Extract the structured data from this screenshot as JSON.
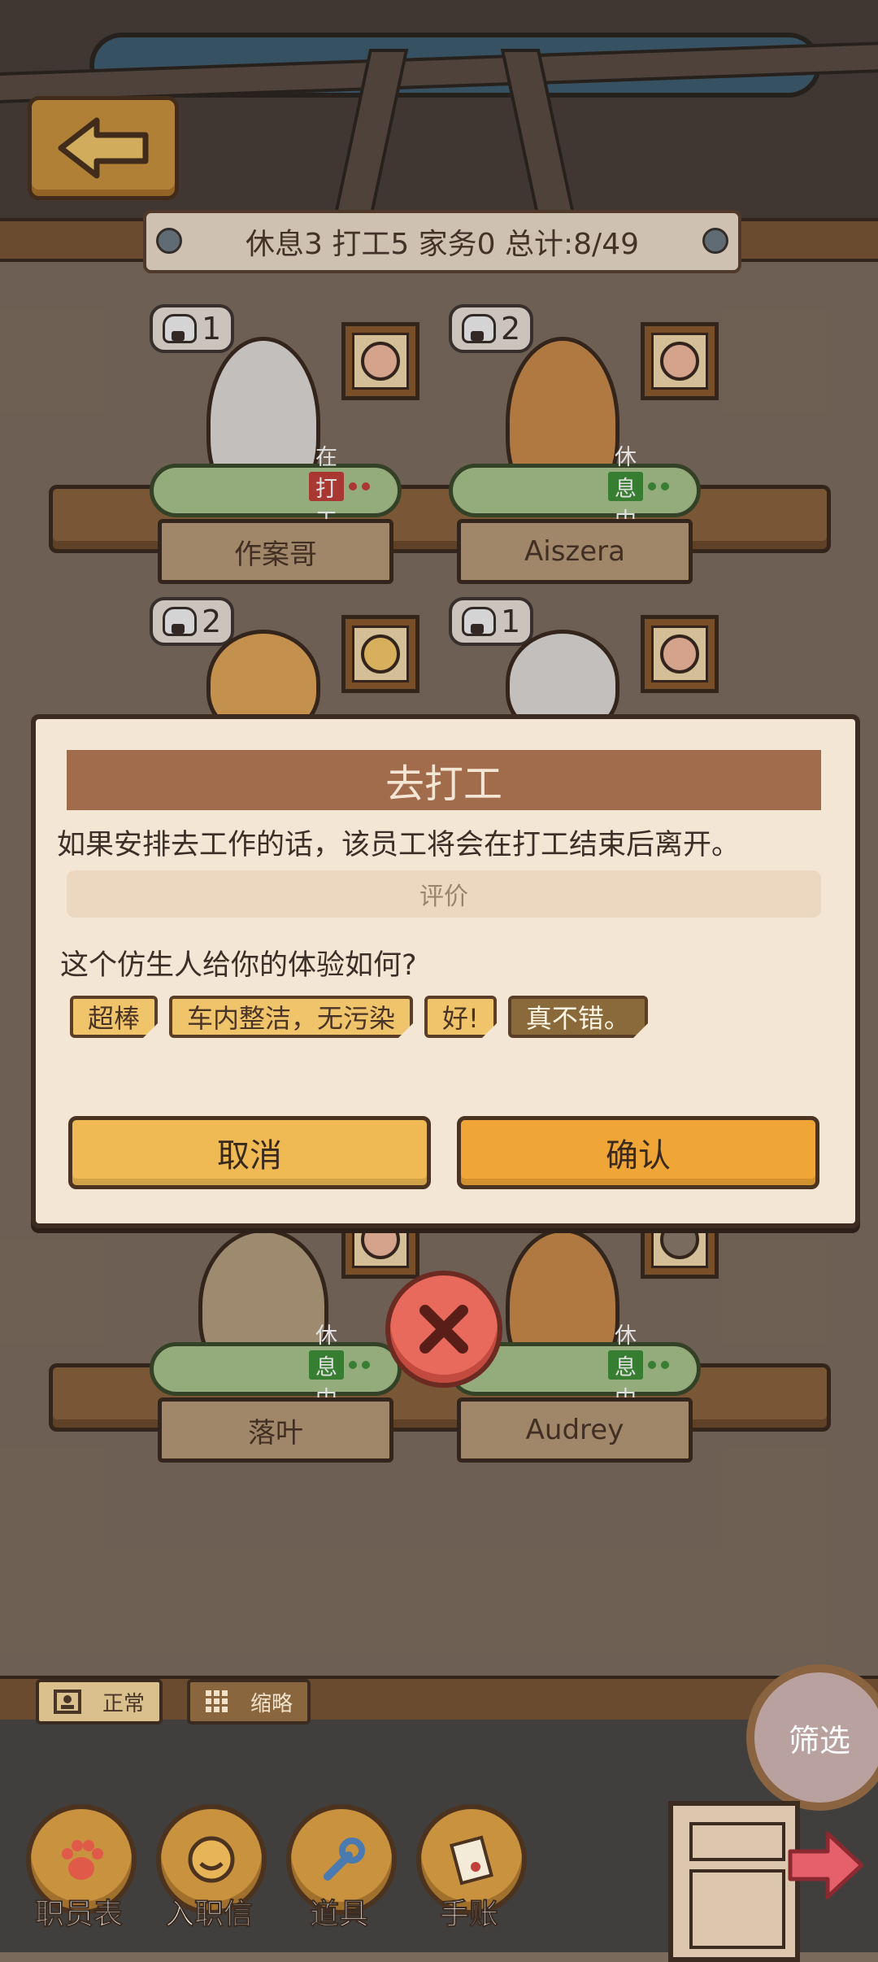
{
  "header": {
    "back_icon": "arrow-left-icon",
    "summary": "休息3 打工5 家务0 总计:8/49"
  },
  "staff": [
    {
      "name": "作案哥",
      "count": "1",
      "status": "在打工",
      "status_color": "#c2403a"
    },
    {
      "name": "Aiszera",
      "count": "2",
      "status": "休息中",
      "status_color": "#3f8f3a"
    },
    {
      "name": "",
      "count": "2",
      "status": "",
      "status_color": ""
    },
    {
      "name": "",
      "count": "1",
      "status": "",
      "status_color": ""
    },
    {
      "name": "落叶",
      "count": "",
      "status": "休息中",
      "status_color": "#3f8f3a"
    },
    {
      "name": "Audrey",
      "count": "",
      "status": "休息中",
      "status_color": "#3f8f3a"
    }
  ],
  "dialog": {
    "title": "去打工",
    "message": "如果安排去工作的话，该员工将会在打工结束后离开。",
    "rating_label": "评价",
    "question": "这个仿生人给你的体验如何?",
    "tags": [
      {
        "label": "超棒",
        "selected": false
      },
      {
        "label": "车内整洁，无污染",
        "selected": false
      },
      {
        "label": "好!",
        "selected": false
      },
      {
        "label": "真不错。",
        "selected": true
      }
    ],
    "cancel": "取消",
    "confirm": "确认",
    "close_icon": "close-icon"
  },
  "view_toggle": {
    "normal": "正常",
    "thumbnail": "缩略"
  },
  "filter": "筛选",
  "nav": [
    {
      "label": "职员表",
      "icon": "paw-icon"
    },
    {
      "label": "入职信",
      "icon": "coin-icon"
    },
    {
      "label": "道具",
      "icon": "wrench-icon"
    },
    {
      "label": "手账",
      "icon": "notebook-icon"
    }
  ],
  "colors": {
    "accent": "#f0a636",
    "panel": "#f4e6d4",
    "wood": "#8a633e"
  }
}
